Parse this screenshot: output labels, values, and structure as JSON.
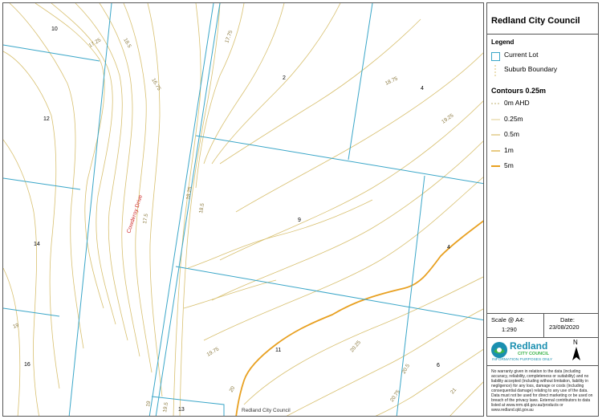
{
  "panel": {
    "title": "Redland City Council",
    "legend_title": "Legend",
    "legend_items": {
      "current_lot": "Current Lot",
      "suburb_boundary": "Suburb Boundary"
    },
    "contours_title": "Contours 0.25m",
    "contour_items": [
      "0m AHD",
      "0.25m",
      "0.5m",
      "1m",
      "5m"
    ],
    "scale_label": "Scale @ A4:",
    "scale_value": "1:290",
    "date_label": "Date:",
    "date_value": "23/08/2020",
    "logo_name": "Redland",
    "logo_sub": "CITY COUNCIL",
    "logo_note": "INFORMATION PURPOSES ONLY",
    "north_letter": "N",
    "disclaimer": "No warranty given in relation to the data (including accuracy, reliability, completeness or suitability) and no liability accepted (including without limitation, liability in negligence) for any loss, damage or costs (including consequential damage) relating to any use of the data. Data must not be used for direct marketing or be used on breach of the privacy laws. External contributors to data listed at www.nrm.qld.gov.au/products or www.redland.qld.gov.au"
  },
  "map": {
    "lot_labels": [
      "10",
      "2",
      "4",
      "12",
      "9",
      "14",
      "4",
      "11",
      "16",
      "6",
      "13"
    ],
    "street_name": "Cowderoy Drive",
    "contour_labels": [
      "17.25",
      "18.5",
      "16.75",
      "17.75",
      "18.75",
      "19.25",
      "17.5",
      "18.25",
      "18.5",
      "19",
      "19.75",
      "20.25",
      "20",
      "20.5",
      "20.75",
      "19",
      "19.5",
      "21"
    ],
    "attribution": "Redland City Council"
  },
  "colors": {
    "lot_boundary": "#3aa6c8",
    "contour_minor": "#d8c070",
    "contour_major": "#e8a020",
    "street_label": "#d03030"
  }
}
